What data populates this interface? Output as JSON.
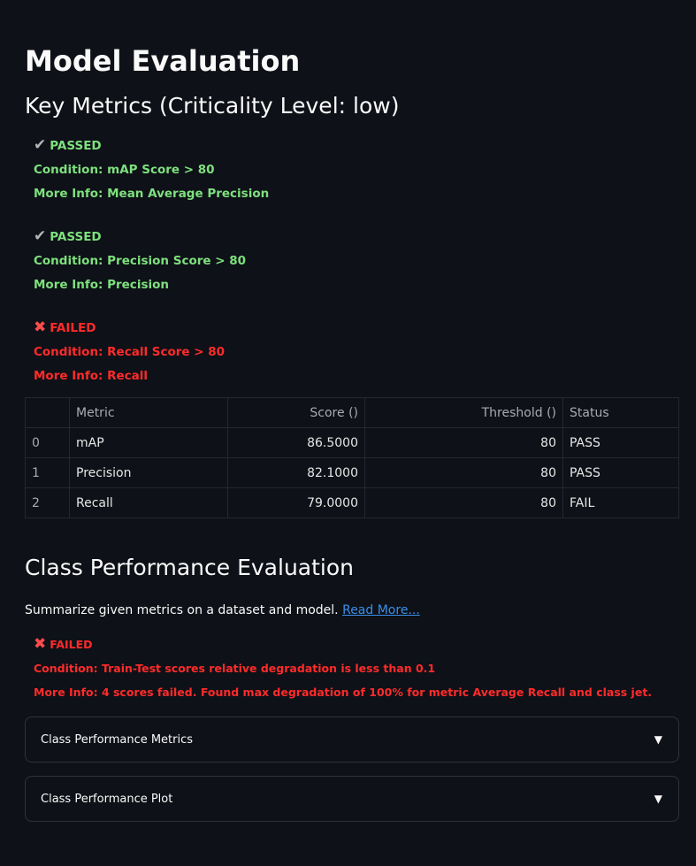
{
  "page": {
    "title": "Model Evaluation",
    "key_metrics_heading": "Key Metrics (Criticality Level: low)"
  },
  "checks": [
    {
      "status": "PASSED",
      "icon": "check-icon",
      "condition": "Condition: mAP Score > 80",
      "info": "More Info: Mean Average Precision"
    },
    {
      "status": "PASSED",
      "icon": "check-icon",
      "condition": "Condition: Precision Score > 80",
      "info": "More Info: Precision"
    },
    {
      "status": "FAILED",
      "icon": "cross-icon",
      "condition": "Condition: Recall Score > 80",
      "info": "More Info: Recall"
    }
  ],
  "metrics_table": {
    "headers": [
      "",
      "Metric",
      "Score ()",
      "Threshold ()",
      "Status"
    ],
    "rows": [
      [
        "0",
        "mAP",
        "86.5000",
        "80",
        "PASS"
      ],
      [
        "1",
        "Precision",
        "82.1000",
        "80",
        "PASS"
      ],
      [
        "2",
        "Recall",
        "79.0000",
        "80",
        "FAIL"
      ]
    ]
  },
  "class_section": {
    "heading": "Class Performance Evaluation",
    "description": "Summarize given metrics on a dataset and model.",
    "read_more": "Read More...",
    "check": {
      "status": "FAILED",
      "condition": "Condition: Train-Test scores relative degradation is less than 0.1",
      "info": "More Info: 4 scores failed. Found max degradation of 100% for metric Average Recall and class jet."
    },
    "expanders": [
      "Class Performance Metrics",
      "Class Performance Plot"
    ]
  },
  "colors": {
    "pass": "#7ee07e",
    "fail": "#ff2b2b",
    "link": "#3b8eea",
    "background": "#0e1117"
  }
}
